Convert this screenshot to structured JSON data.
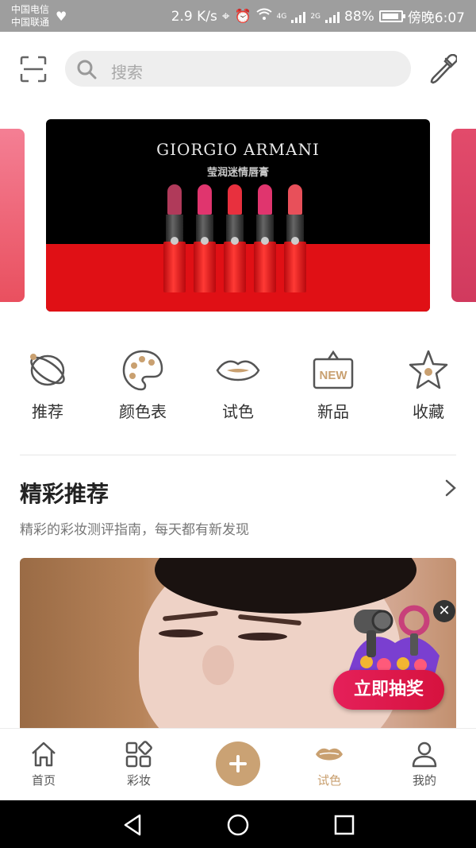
{
  "status_bar": {
    "carrier_1": "中国电信",
    "carrier_2": "中国联通",
    "speed": "2.9 K/s",
    "net_4g": "4G",
    "net_2g": "2G",
    "battery": "88%",
    "time": "傍晚6:07"
  },
  "search": {
    "placeholder": "搜索"
  },
  "banner": {
    "brand": "GIORGIO ARMANI",
    "subtitle": "莹润迷情唇膏",
    "lipstick_colors": [
      "#b03a5a",
      "#e0356e",
      "#e8303e",
      "#e0356e",
      "#e8505a"
    ]
  },
  "categories": [
    {
      "label": "推荐",
      "icon": "atom-icon"
    },
    {
      "label": "颜色表",
      "icon": "palette-icon"
    },
    {
      "label": "试色",
      "icon": "lips-icon"
    },
    {
      "label": "新品",
      "icon": "new-sign-icon",
      "badge": "NEW"
    },
    {
      "label": "收藏",
      "icon": "star-icon"
    }
  ],
  "section": {
    "title": "精彩推荐",
    "description": "精彩的彩妆测评指南，每天都有新发现"
  },
  "promo": {
    "button_label": "立即抽奖"
  },
  "tabbar": {
    "tabs": [
      {
        "label": "首页",
        "icon": "home-icon"
      },
      {
        "label": "彩妆",
        "icon": "grid-icon"
      },
      {
        "label": "试色",
        "icon": "lips-icon",
        "active": true
      },
      {
        "label": "我的",
        "icon": "person-icon"
      }
    ]
  },
  "colors": {
    "accent": "#c9a070",
    "banner_red": "#e01015"
  }
}
